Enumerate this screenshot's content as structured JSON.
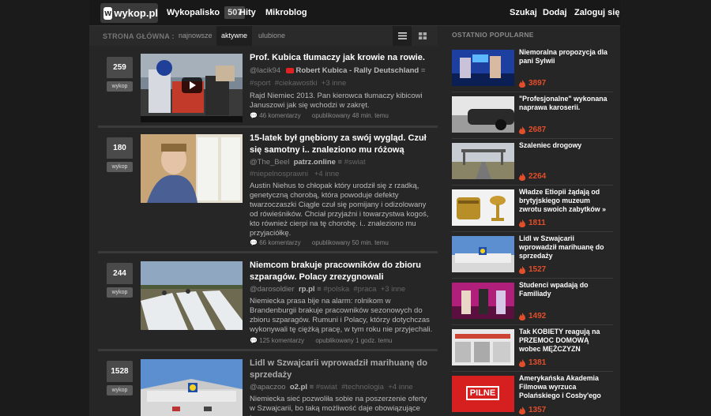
{
  "header": {
    "logo_mark": "w",
    "logo_text": "wykop.pl",
    "nav": [
      {
        "label": "Wykopalisko",
        "badge": "507"
      },
      {
        "label": "Hity"
      },
      {
        "label": "Mikroblog"
      }
    ],
    "right": [
      "Szukaj",
      "Dodaj",
      "Zaloguj się"
    ]
  },
  "tabs": {
    "label": "STRONA GŁÓWNA :",
    "items": [
      "najnowsze",
      "aktywne",
      "ulubione"
    ],
    "active": "aktywne"
  },
  "entries": [
    {
      "votes": "259",
      "vote_label": "wykop",
      "title": "Prof. Kubica tłumaczy jak krowie na rowie.",
      "author": "@lacik94",
      "source": "Robert Kubica - Rally Deutschland",
      "tags": [
        "#sport",
        "#ciekawostki",
        "+3 inne"
      ],
      "description": "Rajd Niemiec 2013. Pan kierowca tłumaczy kibicowi Januszowi jak się wchodzi w zakręt.",
      "comments": "46 komentarzy",
      "published": "opublikowany 48 min. temu"
    },
    {
      "votes": "180",
      "vote_label": "wykop",
      "title": "15-latek był gnębiony za swój wygląd. Czuł się samotny i.. znaleziono mu różową",
      "author": "@The_Beel",
      "source": "patrz.online",
      "tags": [
        "#swiat",
        "#niepelnosprawni",
        "+4 inne"
      ],
      "description": "Austin Niehus to chłopak który urodził się z rzadką, genetyczną chorobą, która powoduje defekty twarzoczaszki Ciągle czuł się pomijany i odizolowany od rówieśników. Chciał przyjaźni i towarzystwa kogoś, kto również cierpi na tę chorobę. i.. znaleziono mu przyjaciółkę.",
      "comments": "66 komentarzy",
      "published": "opublikowany 50 min. temu"
    },
    {
      "votes": "244",
      "vote_label": "wykop",
      "title": "Niemcom brakuje pracowników do zbioru szparagów. Polacy zrezygnowali",
      "author": "@darosoldier",
      "source": "rp.pl",
      "tags": [
        "#polska",
        "#praca",
        "+3 inne"
      ],
      "description": "Niemiecka prasa bije na alarm: rolnikom w Brandenburgii brakuje pracowników sezonowych do zbioru szparagów. Rumuni i Polacy, którzy dotychczas wykonywali tę ciężką pracę, w tym roku nie przyjechali.",
      "comments": "125 komentarzy",
      "published": "opublikowany 1 godz. temu"
    },
    {
      "votes": "1528",
      "vote_label": "wykop",
      "title": "Lidl w Szwajcarii wprowadził marihuanę do sprzedaży",
      "author": "@apaczoo",
      "source": "o2.pl",
      "tags": [
        "#swiat",
        "#technologia",
        "+4 inne"
      ],
      "description": "Niemiecka sieć pozwoliła sobie na poszerzenie oferty w Szwajcarii, bo taką możliwość daje obowiązujące tam",
      "comments": "",
      "published": ""
    }
  ],
  "sidebar": {
    "title": "OSTATNIO POPULARNE",
    "items": [
      {
        "title": "Niemoralna propozycja dla pani Sylwii",
        "count": "3897"
      },
      {
        "title": "\"Profesjonalne\" wykonana naprawa karoserii.",
        "count": "2687"
      },
      {
        "title": "Szaleniec drogowy",
        "count": "2264"
      },
      {
        "title": "Władze Etiopii żądają od brytyjskiego muzeum zwrotu swoich zabytków »",
        "count": "1811"
      },
      {
        "title": "Lidl w Szwajcarii wprowadził marihuanę do sprzedaży",
        "count": "1527"
      },
      {
        "title": "Studenci wpadają do Familiady",
        "count": "1492"
      },
      {
        "title": "Tak KOBIETY reagują na PRZEMOC DOMOWĄ wobec MĘŻCZYZN",
        "count": "1381"
      },
      {
        "title": "Amerykańska Akademia Filmowa wyrzuca Polańskiego i Cosby'ego",
        "count": "1357"
      }
    ],
    "thumb_badge": "PILNE"
  },
  "colors": {
    "accent_orange": "#e24e2a",
    "background": "#1b1b1b",
    "panel": "#262626"
  }
}
